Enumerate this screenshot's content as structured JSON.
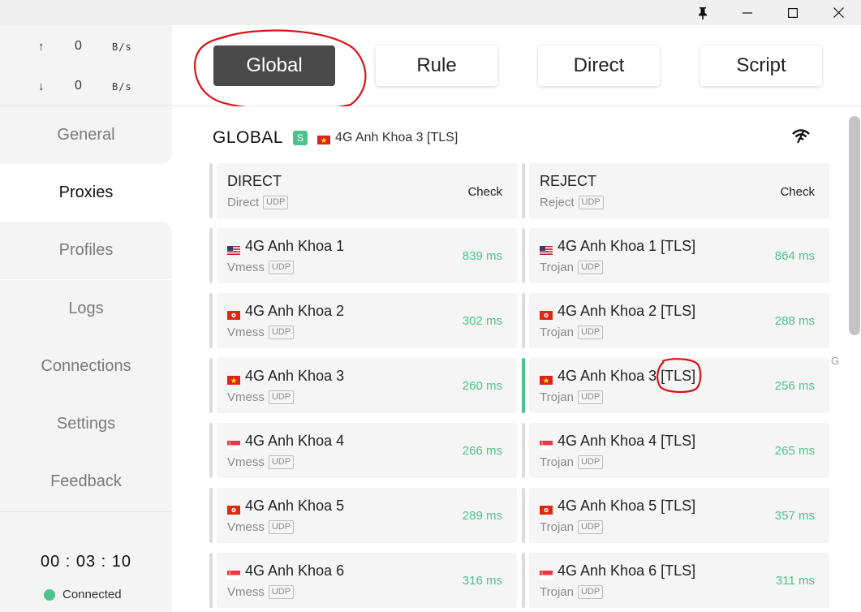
{
  "titlebar": {
    "pin_icon": "pin-icon",
    "minimize_icon": "minimize-icon",
    "maximize_icon": "maximize-icon",
    "close_icon": "close-icon"
  },
  "traffic": {
    "up_arrow": "↑",
    "up_value": "0",
    "up_unit": "B/s",
    "down_arrow": "↓",
    "down_value": "0",
    "down_unit": "B/s"
  },
  "nav": {
    "items": [
      {
        "label": "General"
      },
      {
        "label": "Proxies"
      },
      {
        "label": "Profiles"
      },
      {
        "label": "Logs"
      },
      {
        "label": "Connections"
      },
      {
        "label": "Settings"
      },
      {
        "label": "Feedback"
      }
    ],
    "active": "Proxies"
  },
  "status": {
    "timer": "00 : 03 : 10",
    "connection": "Connected",
    "color": "#4cc38a"
  },
  "modes": {
    "global": "Global",
    "rule": "Rule",
    "direct": "Direct",
    "script": "Script",
    "active": "Global"
  },
  "group": {
    "name": "GLOBAL",
    "badge": "S",
    "selected": "4G Anh Khoa 3 [TLS]",
    "selected_flag": "vn"
  },
  "proxies": {
    "left": [
      {
        "name": "DIRECT",
        "type": "Direct",
        "udp": "UDP",
        "right": "Check",
        "flag": ""
      },
      {
        "name": "4G Anh Khoa 1",
        "type": "Vmess",
        "udp": "UDP",
        "right": "839 ms",
        "flag": "us"
      },
      {
        "name": "4G Anh Khoa 2",
        "type": "Vmess",
        "udp": "UDP",
        "right": "302 ms",
        "flag": "hk"
      },
      {
        "name": "4G Anh Khoa 3",
        "type": "Vmess",
        "udp": "UDP",
        "right": "260 ms",
        "flag": "vn"
      },
      {
        "name": "4G Anh Khoa 4",
        "type": "Vmess",
        "udp": "UDP",
        "right": "266 ms",
        "flag": "sg"
      },
      {
        "name": "4G Anh Khoa 5",
        "type": "Vmess",
        "udp": "UDP",
        "right": "289 ms",
        "flag": "hk"
      },
      {
        "name": "4G Anh Khoa 6",
        "type": "Vmess",
        "udp": "UDP",
        "right": "316 ms",
        "flag": "sg"
      }
    ],
    "right": [
      {
        "name": "REJECT",
        "type": "Reject",
        "udp": "UDP",
        "right": "Check",
        "flag": ""
      },
      {
        "name": "4G Anh Khoa 1 [TLS]",
        "type": "Trojan",
        "udp": "UDP",
        "right": "864 ms",
        "flag": "us"
      },
      {
        "name": "4G Anh Khoa 2 [TLS]",
        "type": "Trojan",
        "udp": "UDP",
        "right": "288 ms",
        "flag": "hk"
      },
      {
        "name": "4G Anh Khoa 3 [TLS]",
        "type": "Trojan",
        "udp": "UDP",
        "right": "256 ms",
        "flag": "vn"
      },
      {
        "name": "4G Anh Khoa 4 [TLS]",
        "type": "Trojan",
        "udp": "UDP",
        "right": "265 ms",
        "flag": "sg"
      },
      {
        "name": "4G Anh Khoa 5 [TLS]",
        "type": "Trojan",
        "udp": "UDP",
        "right": "357 ms",
        "flag": "hk"
      },
      {
        "name": "4G Anh Khoa 6 [TLS]",
        "type": "Trojan",
        "udp": "UDP",
        "right": "311 ms",
        "flag": "sg"
      }
    ],
    "selected_name": "4G Anh Khoa 3 [TLS]"
  },
  "edge_letter": "G",
  "colors": {
    "accent": "#4cc38a",
    "mode_active": "#4a4a4a",
    "annotation": "#d9141a"
  }
}
